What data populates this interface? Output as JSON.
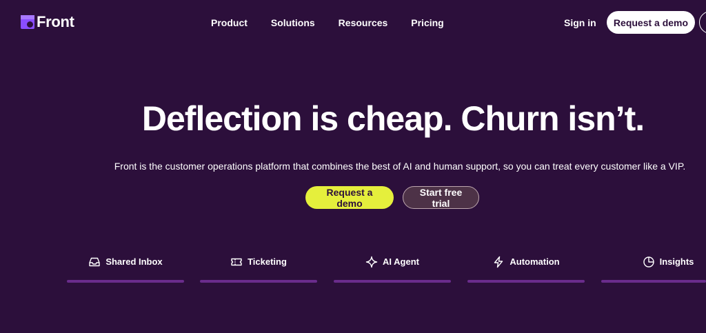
{
  "header": {
    "logo_text": "Front",
    "nav": [
      {
        "label": "Product"
      },
      {
        "label": "Solutions"
      },
      {
        "label": "Resources"
      },
      {
        "label": "Pricing"
      }
    ],
    "sign_in": "Sign in",
    "request_demo": "Request a demo"
  },
  "hero": {
    "title": "Deflection is cheap. Churn isn’t.",
    "subtitle": "Front is the customer operations platform that combines the best of AI and human support, so you can treat every customer like a VIP.",
    "primary_cta": "Request a demo",
    "secondary_cta": "Start free trial"
  },
  "tabs": [
    {
      "label": "Shared Inbox",
      "icon": "inbox-icon"
    },
    {
      "label": "Ticketing",
      "icon": "ticket-icon"
    },
    {
      "label": "AI Agent",
      "icon": "sparkle-icon"
    },
    {
      "label": "Automation",
      "icon": "lightning-icon"
    },
    {
      "label": "Insights",
      "icon": "pie-chart-icon"
    }
  ],
  "colors": {
    "background": "#2c0f3b",
    "brand_purple": "#8a4dff",
    "primary_button": "#e5ef3c",
    "tab_bar": "#6a2c8c"
  }
}
